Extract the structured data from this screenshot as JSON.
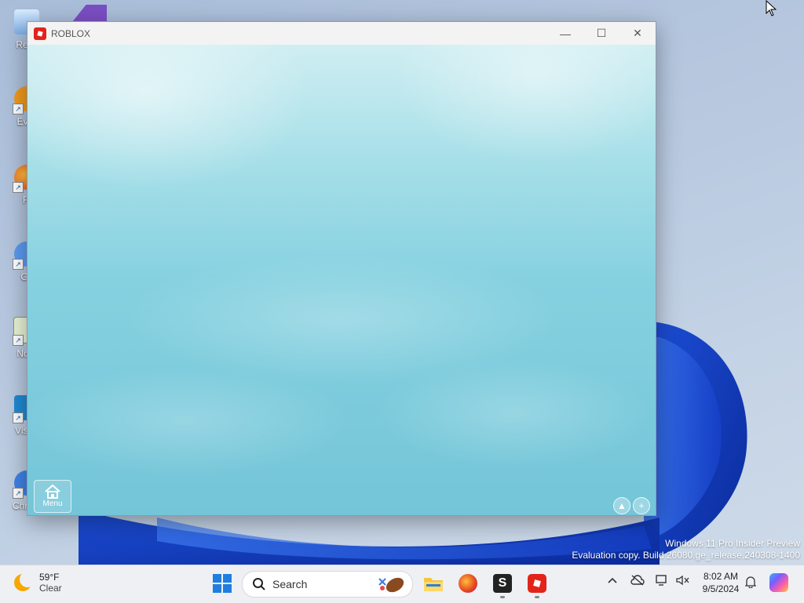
{
  "window": {
    "title": "ROBLOX",
    "controls": {
      "minimize": "—",
      "maximize": "☐",
      "close": "✕"
    },
    "menu_label": "Menu"
  },
  "desktop": {
    "icons": [
      {
        "label": "Recy",
        "name": "recycle-bin"
      },
      {
        "label": "Ever",
        "name": "everything"
      },
      {
        "label": "Fi",
        "name": "firefox"
      },
      {
        "label": "Git",
        "name": "git"
      },
      {
        "label": "Note",
        "name": "notepad-plus-plus"
      },
      {
        "label": "Visua",
        "name": "visual-studio-code"
      },
      {
        "label": "Chrom",
        "name": "chromium"
      }
    ],
    "watermark": {
      "line1": "Windows 11 Pro Insider Preview",
      "line2": "Evaluation copy. Build 26080.ge_release.240308-1400"
    }
  },
  "taskbar": {
    "weather": {
      "temp": "59°F",
      "condition": "Clear"
    },
    "search_label": "Search",
    "clock": {
      "time": "8:02 AM",
      "date": "9/5/2024"
    }
  },
  "colors": {
    "sky_top": "#cfeef2",
    "sky_bottom": "#74c5d8",
    "roblox_red": "#e2231a",
    "taskbar_bg": "#eef0f4",
    "win_blue": "#1f7fe0"
  }
}
